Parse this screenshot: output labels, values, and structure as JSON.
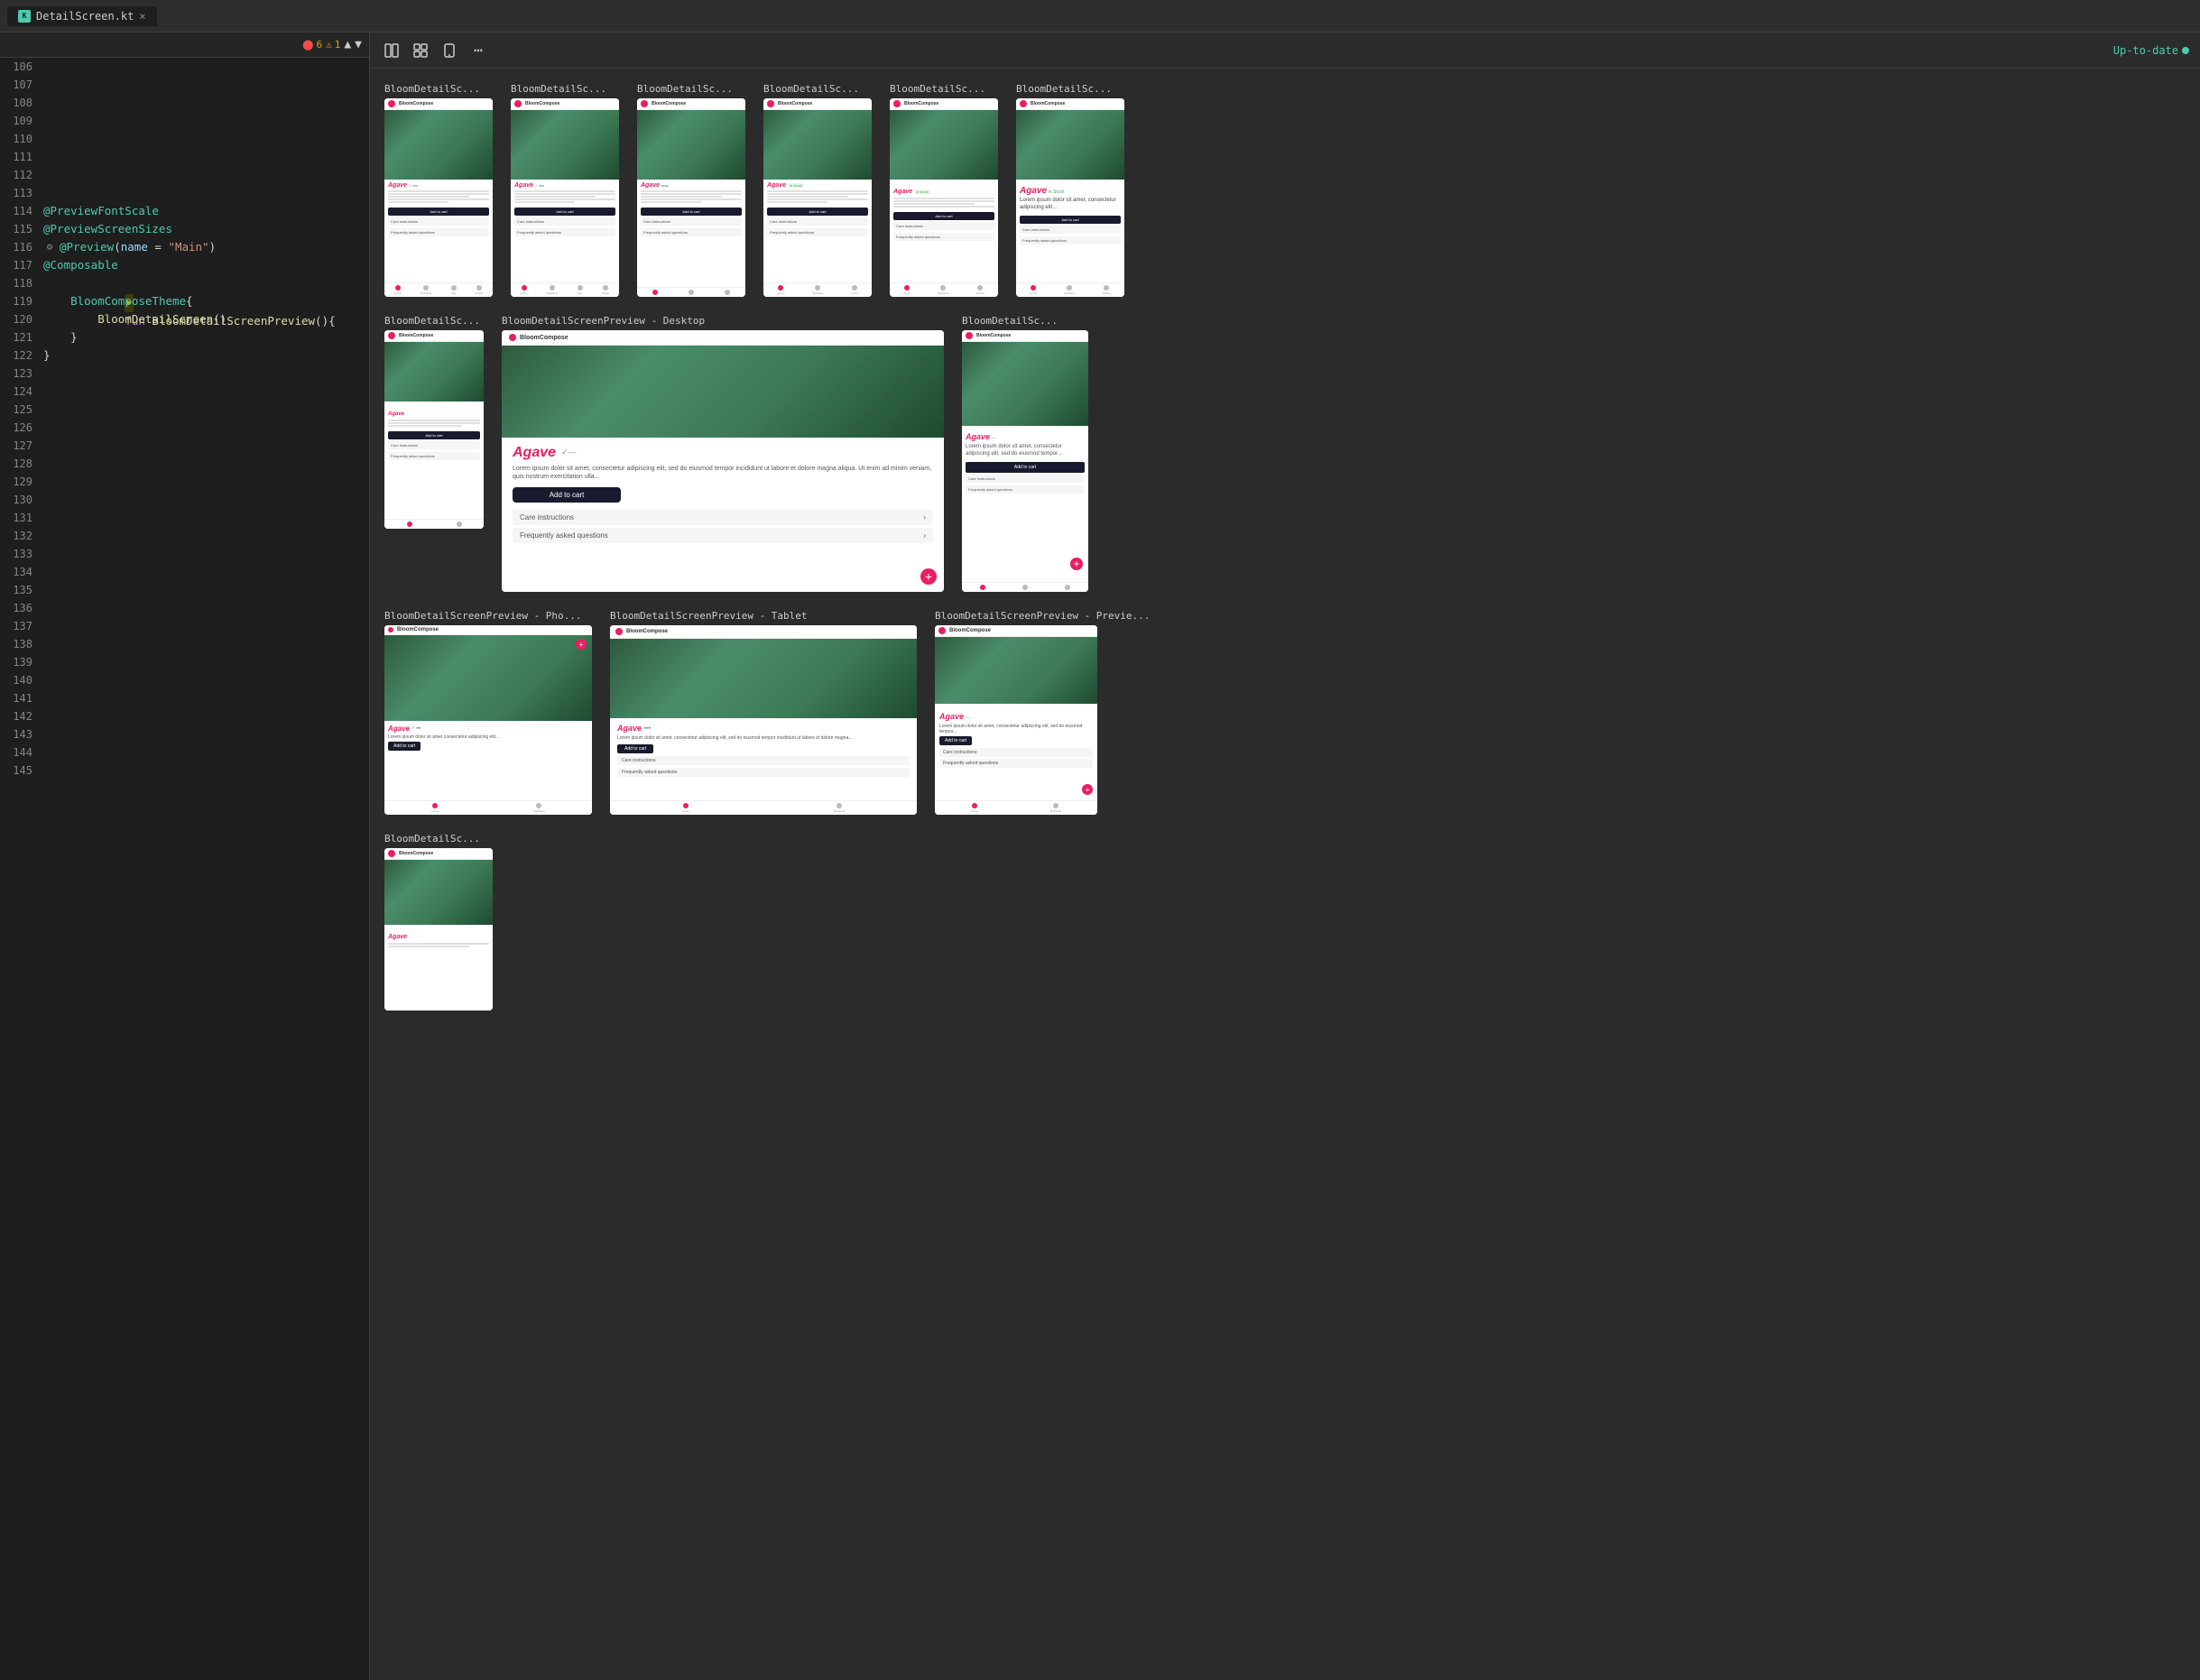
{
  "tab": {
    "filename": "DetailScreen.kt",
    "close_label": "×",
    "icon_text": "K"
  },
  "code_toolbar": {
    "warnings": "6",
    "errors": "1",
    "arrow_up": "▲",
    "arrow_down": "▼"
  },
  "code_lines": [
    {
      "num": "106",
      "content": ""
    },
    {
      "num": "107",
      "content": ""
    },
    {
      "num": "108",
      "content": ""
    },
    {
      "num": "109",
      "content": ""
    },
    {
      "num": "110",
      "content": ""
    },
    {
      "num": "111",
      "content": ""
    },
    {
      "num": "112",
      "content": ""
    },
    {
      "num": "113",
      "content": ""
    },
    {
      "num": "114",
      "content": "@PreviewFontScale",
      "type": "annotation"
    },
    {
      "num": "115",
      "content": "@PreviewScreenSizes",
      "type": "annotation"
    },
    {
      "num": "116",
      "content": "@Preview(name = \"Main\")",
      "type": "annotation",
      "has_gear": true
    },
    {
      "num": "117",
      "content": "@Composable",
      "type": "annotation"
    },
    {
      "num": "118",
      "content": "fun BloomDetailScreenPreview(){",
      "type": "function",
      "has_icon": true
    },
    {
      "num": "119",
      "content": "    BloomComposeTheme{",
      "type": "class"
    },
    {
      "num": "120",
      "content": "        BloomDetailScreen()",
      "type": "function_call"
    },
    {
      "num": "121",
      "content": "    }",
      "type": "plain"
    },
    {
      "num": "122",
      "content": "}",
      "type": "plain"
    },
    {
      "num": "123",
      "content": ""
    },
    {
      "num": "124",
      "content": ""
    },
    {
      "num": "125",
      "content": ""
    },
    {
      "num": "126",
      "content": ""
    },
    {
      "num": "127",
      "content": ""
    },
    {
      "num": "128",
      "content": ""
    },
    {
      "num": "129",
      "content": ""
    },
    {
      "num": "130",
      "content": ""
    },
    {
      "num": "131",
      "content": ""
    },
    {
      "num": "132",
      "content": ""
    },
    {
      "num": "133",
      "content": ""
    },
    {
      "num": "134",
      "content": ""
    },
    {
      "num": "135",
      "content": ""
    },
    {
      "num": "136",
      "content": ""
    },
    {
      "num": "137",
      "content": ""
    },
    {
      "num": "138",
      "content": ""
    },
    {
      "num": "139",
      "content": ""
    },
    {
      "num": "140",
      "content": ""
    },
    {
      "num": "141",
      "content": ""
    },
    {
      "num": "142",
      "content": ""
    },
    {
      "num": "143",
      "content": ""
    },
    {
      "num": "144",
      "content": ""
    },
    {
      "num": "145",
      "content": ""
    }
  ],
  "preview_panel": {
    "status": "Up-to-date",
    "grid_icon": "⊞",
    "layout_icon": "☰",
    "phone_icon": "📱",
    "more_icon": "⋯"
  },
  "previews_row1": [
    {
      "title": "BloomDetailSc...",
      "type": "mobile"
    },
    {
      "title": "BloomDetailSc...",
      "type": "mobile"
    },
    {
      "title": "BloomDetailSc...",
      "type": "mobile"
    },
    {
      "title": "BloomDetailSc...",
      "type": "mobile"
    },
    {
      "title": "BloomDetailSc...",
      "type": "mobile"
    },
    {
      "title": "BloomDetailSc...",
      "type": "mobile"
    }
  ],
  "previews_row2_left": {
    "title": "BloomDetailSc...",
    "type": "mobile-sm"
  },
  "previews_row2_center": {
    "title": "BloomDetailScreenPreview - Desktop",
    "type": "desktop"
  },
  "previews_row2_right": {
    "title": "BloomDetailSc...",
    "type": "mobile-sm2"
  },
  "previews_row3": [
    {
      "title": "BloomDetailScreenPreview - Pho...",
      "type": "phone-lg"
    },
    {
      "title": "BloomDetailScreenPreview - Tablet",
      "type": "tablet"
    },
    {
      "title": "BloomDetailScreenPreview - Previe...",
      "type": "tablet2"
    }
  ],
  "previews_row4": [
    {
      "title": "BloomDetailSc...",
      "type": "mobile-bottom"
    }
  ],
  "plant": {
    "name": "Agave",
    "stock_status": "In stock",
    "care_instructions": "Care instructions",
    "faq": "Frequently asked questions"
  },
  "brands": {
    "name": "BloomCompose",
    "dot_color": "#e91e63"
  }
}
